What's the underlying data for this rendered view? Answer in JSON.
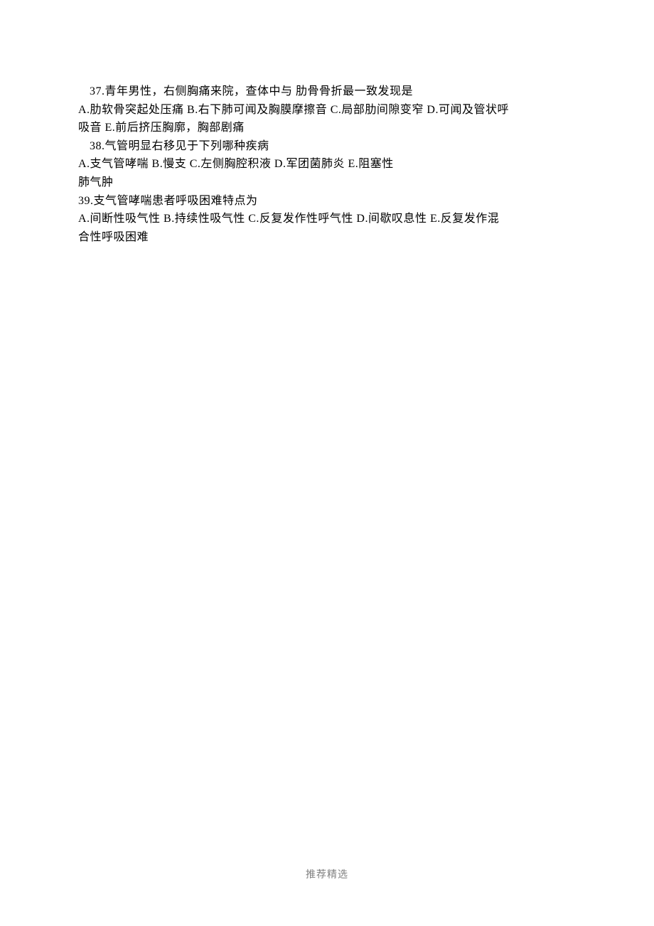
{
  "questions": [
    {
      "number": "37",
      "stem": "青年男性，右侧胸痛来院，查体中与  肋骨骨折最一致发现是",
      "indent": true,
      "options_lines": [
        "A.肋软骨突起处压痛  B.右下肺可闻及胸膜摩擦音  C.局部肋间隙变窄  D.可闻及管状呼",
        "吸音  E.前后挤压胸廓，胸部剧痛"
      ]
    },
    {
      "number": "38",
      "stem": "气管明显右移见于下列哪种疾病",
      "indent": true,
      "options_lines": [
        "  A.支气管哮喘          B.慢支  C.左侧胸腔积液      D.军团菌肺炎  E.阻塞性",
        "肺气肿"
      ]
    },
    {
      "number": "39",
      "stem": "支气管哮喘患者呼吸困难特点为",
      "indent": false,
      "options_lines": [
        "A.间断性吸气性  B.持续性吸气性  C.反复发作性呼气性  D.间歇叹息性  E.反复发作混",
        "合性呼吸困难"
      ]
    }
  ],
  "footer": "推荐精选"
}
